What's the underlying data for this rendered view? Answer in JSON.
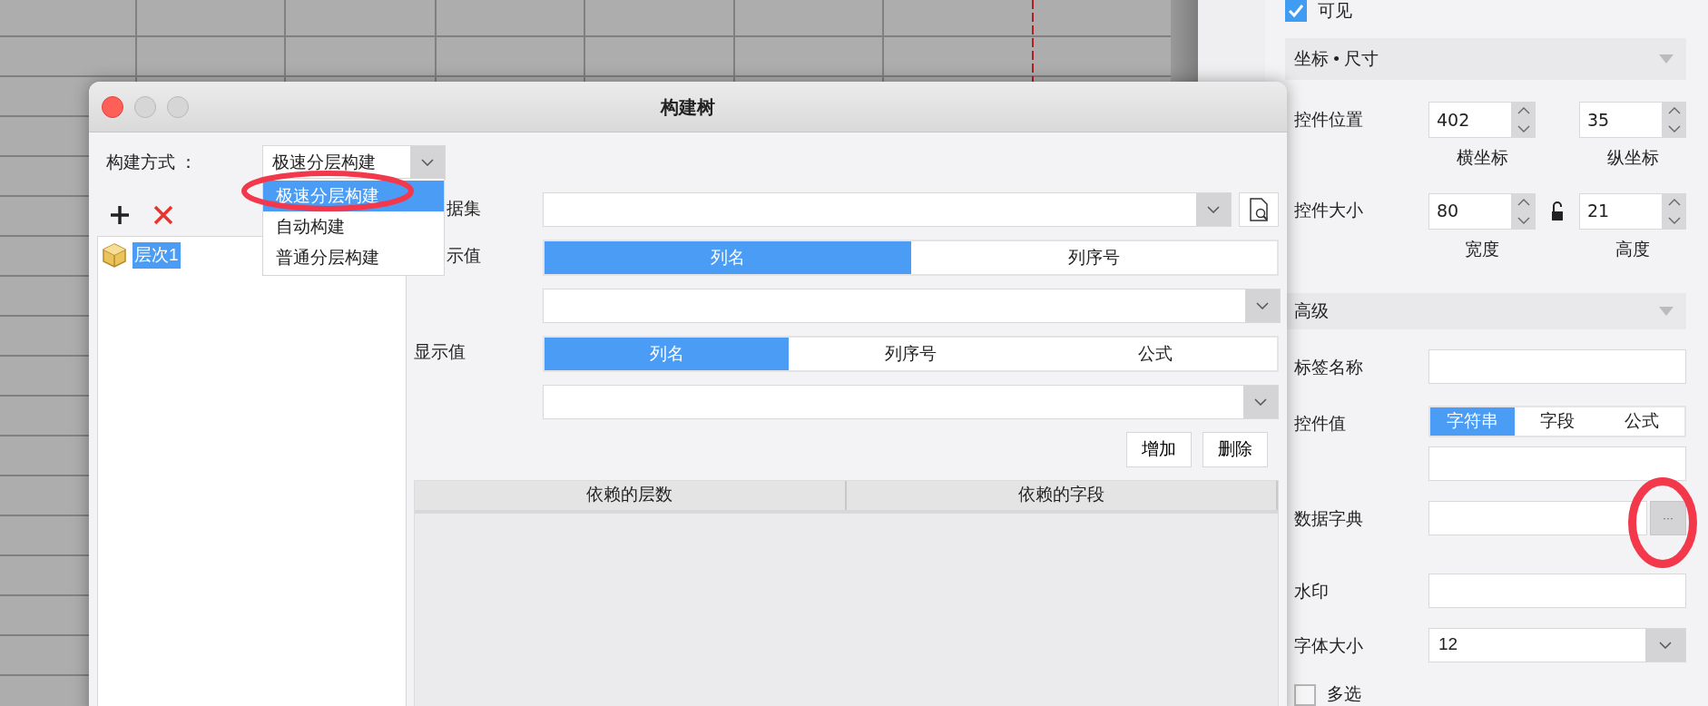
{
  "dialog": {
    "title": "构建树",
    "build_mode": {
      "label": "构建方式 ：",
      "value": "极速分层构建",
      "expanded": true,
      "options": [
        {
          "label": "极速分层构建",
          "selected": true
        },
        {
          "label": "自动构建",
          "selected": false
        },
        {
          "label": "普通分层构建",
          "selected": false
        }
      ]
    },
    "tree": [
      {
        "label": "层次1",
        "selected": true
      }
    ],
    "form": {
      "dataset_label": "据集",
      "actual_label": "示值",
      "actual_modes": [
        {
          "label": "列名",
          "selected": true
        },
        {
          "label": "列序号",
          "selected": false
        }
      ],
      "display_label": "显示值",
      "display_modes": [
        {
          "label": "列名",
          "selected": true
        },
        {
          "label": "列序号",
          "selected": false
        },
        {
          "label": "公式",
          "selected": false
        }
      ],
      "buttons": [
        "增加",
        "删除"
      ],
      "table": {
        "columns": [
          "依赖的层数",
          "依赖的字段"
        ]
      }
    }
  },
  "properties": {
    "visible": {
      "label": "可见",
      "checked": true
    },
    "geometry": {
      "title": "坐标 • 尺寸",
      "expanded": true,
      "position": {
        "label": "控件位置",
        "x": {
          "value": "402",
          "caption": "横坐标"
        },
        "y": {
          "value": "35",
          "caption": "纵坐标"
        }
      },
      "size": {
        "label": "控件大小",
        "locked": false,
        "width": {
          "value": "80",
          "caption": "宽度"
        },
        "height": {
          "value": "21",
          "caption": "高度"
        }
      }
    },
    "advanced": {
      "title": "高级",
      "expanded": true,
      "label_name": {
        "label": "标签名称"
      },
      "control_value": {
        "label": "控件值",
        "modes": [
          {
            "label": "字符串",
            "selected": true
          },
          {
            "label": "字段",
            "selected": false
          },
          {
            "label": "公式",
            "selected": false
          }
        ]
      },
      "data_dictionary": {
        "label": "数据字典",
        "button": "···"
      },
      "watermark": {
        "label": "水印"
      },
      "font_size": {
        "label": "字体大小",
        "value": "12"
      },
      "multi_select": {
        "label": "多选",
        "checked": false
      }
    }
  }
}
